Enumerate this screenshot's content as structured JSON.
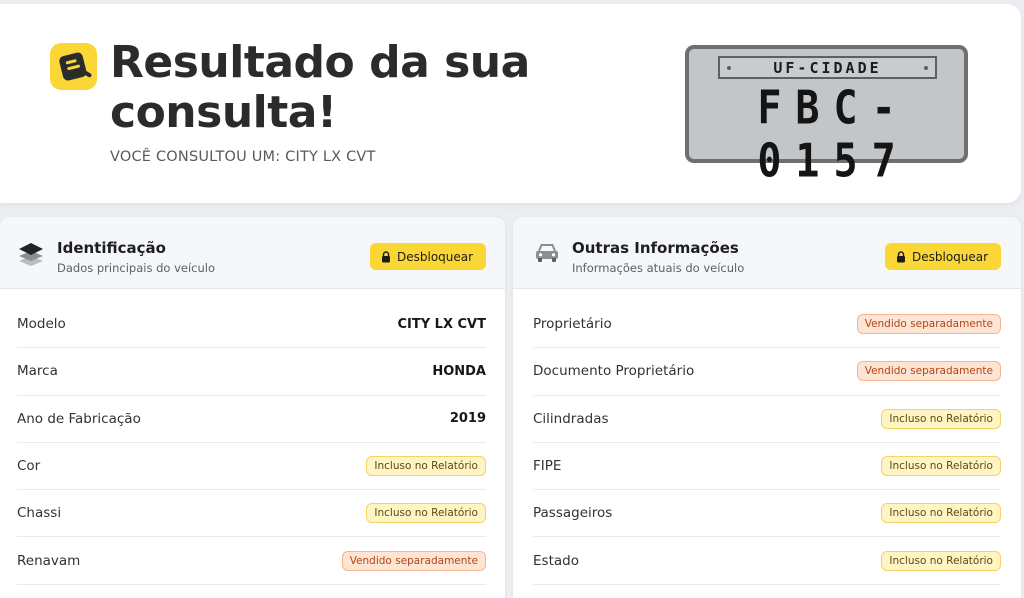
{
  "header": {
    "title": "Resultado da sua consulta!",
    "subtitle": "VOCÊ CONSULTOU UM: CITY LX CVT",
    "logo_icon": "search-car-logo-icon",
    "accent": "#fbd736"
  },
  "plate": {
    "region": "UF-CIDADE",
    "number": "FBC-0157"
  },
  "identification": {
    "title": "Identificação",
    "description": "Dados principais do veículo",
    "icon": "layers-icon",
    "unlock_label": "Desbloquear",
    "rows": [
      {
        "label": "Modelo",
        "value": "CITY LX CVT",
        "kind": "text"
      },
      {
        "label": "Marca",
        "value": "HONDA",
        "kind": "text"
      },
      {
        "label": "Ano de Fabricação",
        "value": "2019",
        "kind": "text"
      },
      {
        "label": "Cor",
        "value": "Incluso no Relatório",
        "kind": "included"
      },
      {
        "label": "Chassi",
        "value": "Incluso no Relatório",
        "kind": "included"
      },
      {
        "label": "Renavam",
        "value": "Vendido separadamente",
        "kind": "sold"
      }
    ]
  },
  "other_info": {
    "title": "Outras Informações",
    "description": "Informações atuais do veículo",
    "icon": "car-icon",
    "unlock_label": "Desbloquear",
    "rows": [
      {
        "label": "Proprietário",
        "value": "Vendido separadamente",
        "kind": "sold"
      },
      {
        "label": "Documento Proprietário",
        "value": "Vendido separadamente",
        "kind": "sold"
      },
      {
        "label": "Cilindradas",
        "value": "Incluso no Relatório",
        "kind": "included"
      },
      {
        "label": "FIPE",
        "value": "Incluso no Relatório",
        "kind": "included"
      },
      {
        "label": "Passageiros",
        "value": "Incluso no Relatório",
        "kind": "included"
      },
      {
        "label": "Estado",
        "value": "Incluso no Relatório",
        "kind": "included"
      }
    ]
  },
  "colors": {
    "included_badge": "#fff5c4",
    "sold_badge": "#fde4d3"
  }
}
